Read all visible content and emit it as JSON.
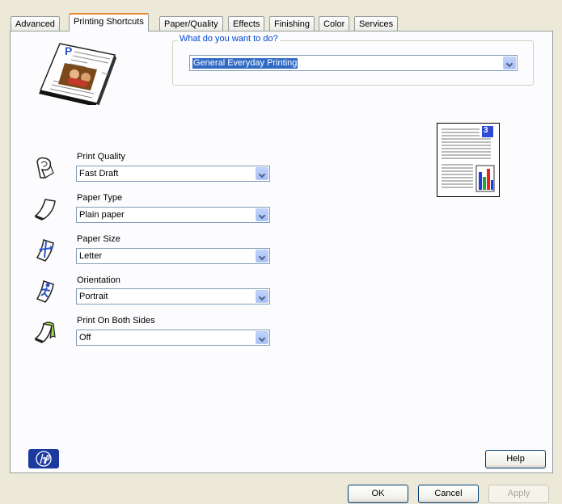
{
  "tabs": [
    "Advanced",
    "Printing Shortcuts",
    "Paper/Quality",
    "Effects",
    "Finishing",
    "Color",
    "Services"
  ],
  "active_tab": "Printing Shortcuts",
  "shortcuts_group": {
    "label": "What do you want to do?",
    "selected": "General Everyday Printing"
  },
  "settings": {
    "print_quality": {
      "label": "Print Quality",
      "value": "Fast Draft"
    },
    "paper_type": {
      "label": "Paper Type",
      "value": "Plain paper"
    },
    "paper_size": {
      "label": "Paper Size",
      "value": "Letter"
    },
    "orientation": {
      "label": "Orientation",
      "value": "Portrait"
    },
    "both_sides": {
      "label": "Print On Both Sides",
      "value": "Off"
    }
  },
  "preview": {
    "page_number": "3"
  },
  "buttons": {
    "help": "Help",
    "ok": "OK",
    "cancel": "Cancel",
    "apply": "Apply"
  },
  "colors": {
    "accent": "#316ac5",
    "group_label": "#0046d5",
    "tab_highlight": "#e68b2c"
  }
}
